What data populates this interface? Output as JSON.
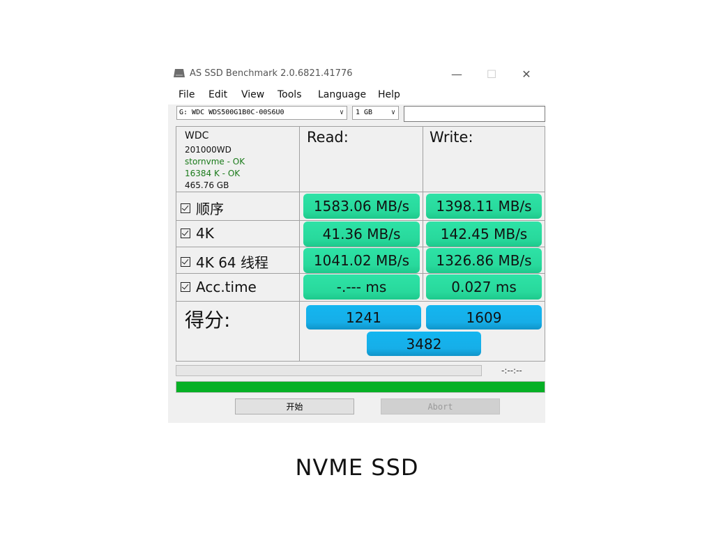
{
  "window": {
    "title": "AS SSD Benchmark 2.0.6821.41776",
    "controls": {
      "minimize": "—",
      "maximize": "☐",
      "close": "✕"
    }
  },
  "menu": [
    "File",
    "Edit",
    "View",
    "Tools",
    "Language",
    "Help"
  ],
  "toolbar": {
    "drive": "G: WDC WDS500G1B0C-00S6U0",
    "size": "1 GB",
    "blank_field": ""
  },
  "drive_info": {
    "vendor": "WDC",
    "firmware": "201000WD",
    "driver_status": "stornvme - OK",
    "alignment_status": "16384 K - OK",
    "capacity": "465.76 GB"
  },
  "columns": {
    "read": "Read:",
    "write": "Write:"
  },
  "rows": [
    {
      "label": "顺序",
      "checked": true,
      "read": "1583.06 MB/s",
      "write": "1398.11 MB/s"
    },
    {
      "label": "4K",
      "checked": true,
      "read": "41.36 MB/s",
      "write": "142.45 MB/s"
    },
    {
      "label": "4K 64 线程",
      "checked": true,
      "read": "1041.02 MB/s",
      "write": "1326.86 MB/s"
    },
    {
      "label": "Acc.time",
      "checked": true,
      "read": "-.--- ms",
      "write": "0.027 ms"
    }
  ],
  "score": {
    "label": "得分:",
    "read": "1241",
    "write": "1609",
    "total": "3482"
  },
  "progress": {
    "time": "-:--:--",
    "overall_fraction": 1.0,
    "overall_color": "#06b025"
  },
  "buttons": {
    "start": "开始",
    "abort": "Abort"
  },
  "caption": "NVME  SSD",
  "colors": {
    "result_green": "#2ee2a6",
    "score_blue": "#14b6f0"
  }
}
